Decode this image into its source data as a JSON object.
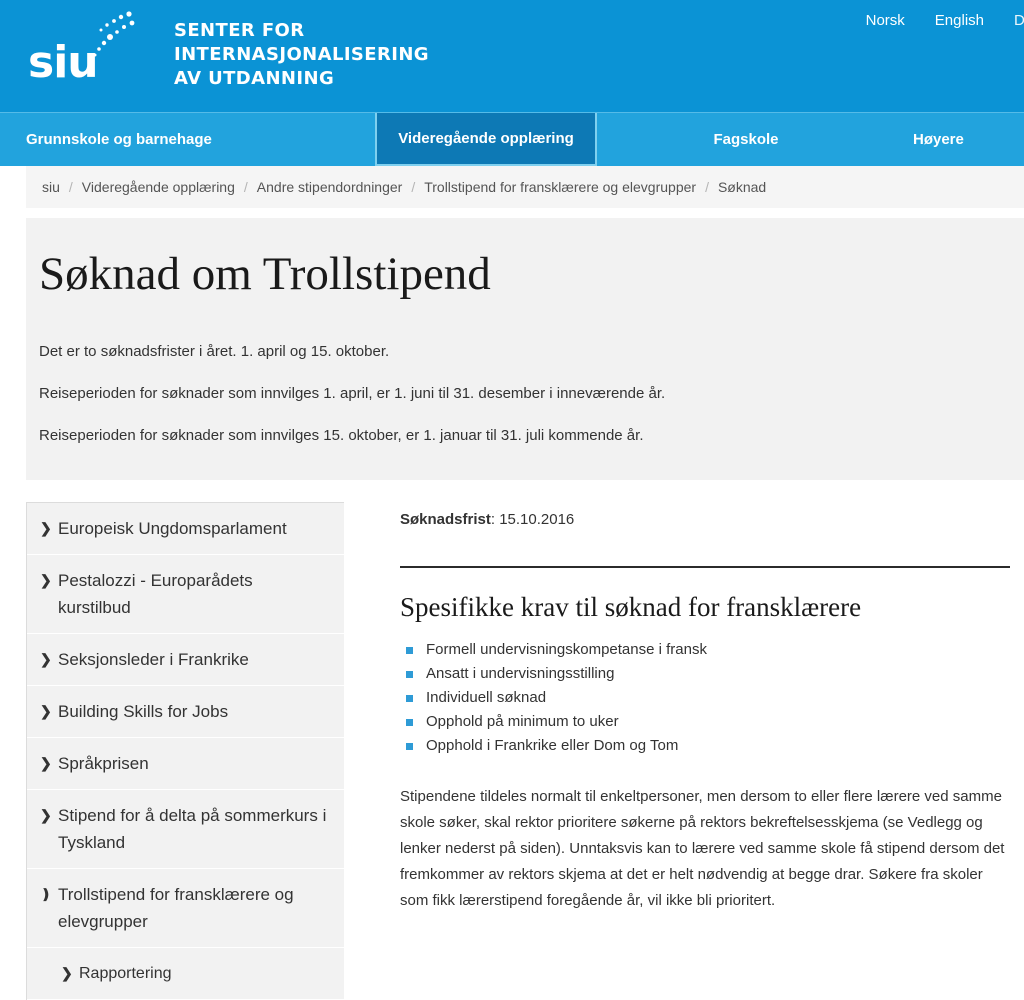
{
  "header": {
    "logo_word": "siu",
    "logo_icon": "siu-dots-logo",
    "brand_lines": [
      "SENTER FOR",
      "INTERNASJONALISERING",
      "AV UTDANNING"
    ],
    "brand_text": "SENTER FOR\nINTERNASJONALISERING\nAV UTDANNING",
    "background_color": "#0b93d5",
    "top_links": [
      {
        "label": "Norsk"
      },
      {
        "label": "English"
      },
      {
        "label": "D"
      }
    ]
  },
  "mainnav": {
    "active_color": "#0d79b5",
    "background_color": "#22a3dd",
    "items": [
      {
        "label": "Grunnskole og barnehage",
        "active": false
      },
      {
        "label": "Videregående opplæring",
        "active": true
      },
      {
        "label": "Fagskole",
        "active": false
      },
      {
        "label": "Høyere",
        "active": false
      }
    ]
  },
  "breadcrumb": {
    "separator": "/",
    "items": [
      {
        "label": "siu"
      },
      {
        "label": "Videregående opplæring"
      },
      {
        "label": "Andre stipendordninger"
      },
      {
        "label": "Trollstipend for fransklærere og elevgrupper"
      },
      {
        "label": "Søknad"
      }
    ]
  },
  "intro": {
    "title": "Søknad om Trollstipend",
    "paragraphs": [
      "Det er to søknadsfrister i året. 1. april og 15. oktober.",
      "Reiseperioden for søknader som innvilges 1. april, er 1. juni til 31. desember i inneværende år.",
      "Reiseperioden for søknader som innvilges 15. oktober, er 1. januar til 31. juli kommende år."
    ]
  },
  "sidebar": {
    "items": [
      {
        "label": "Europeisk Ungdomsparlament",
        "icon": "chevron-right-icon",
        "expanded": false,
        "sub": false
      },
      {
        "label": "Pestalozzi - Europarådets kurstilbud",
        "icon": "chevron-right-icon",
        "expanded": false,
        "sub": false
      },
      {
        "label": "Seksjonsleder i Frankrike",
        "icon": "chevron-right-icon",
        "expanded": false,
        "sub": false
      },
      {
        "label": "Building Skills for Jobs",
        "icon": "chevron-right-icon",
        "expanded": false,
        "sub": false
      },
      {
        "label": "Språkprisen",
        "icon": "chevron-right-icon",
        "expanded": false,
        "sub": false
      },
      {
        "label": "Stipend for å delta på sommerkurs i Tyskland",
        "icon": "chevron-right-icon",
        "expanded": false,
        "sub": false
      },
      {
        "label": "Trollstipend for fransklærere og elevgrupper",
        "icon": "chevron-down-icon",
        "expanded": true,
        "sub": false
      },
      {
        "label": "Rapportering",
        "icon": "chevron-right-icon",
        "expanded": false,
        "sub": true
      }
    ]
  },
  "content": {
    "deadline_label": "Søknadsfrist",
    "deadline_separator": ": ",
    "deadline_value": "15.10.2016",
    "section_title": "Spesifikke krav til søknad for fransklærere",
    "bullet_color": "#2e9bd6",
    "requirements": [
      "Formell undervisningskompetanse i fransk",
      "Ansatt i undervisningsstilling",
      "Individuell søknad",
      "Opphold på minimum to uker",
      "Opphold i Frankrike eller Dom og Tom"
    ],
    "body_paragraph": "Stipendene tildeles normalt til enkeltpersoner, men dersom to eller flere lærere ved samme skole søker, skal rektor prioritere søkerne på rektors bekreftelsesskjema (se Vedlegg og lenker nederst på siden). Unntaksvis kan to lærere ved samme skole få stipend dersom det fremkommer av rektors skjema at det er helt nødvendig at begge drar. Søkere fra skoler som fikk lærerstipend foregående år, vil ikke bli prioritert."
  }
}
